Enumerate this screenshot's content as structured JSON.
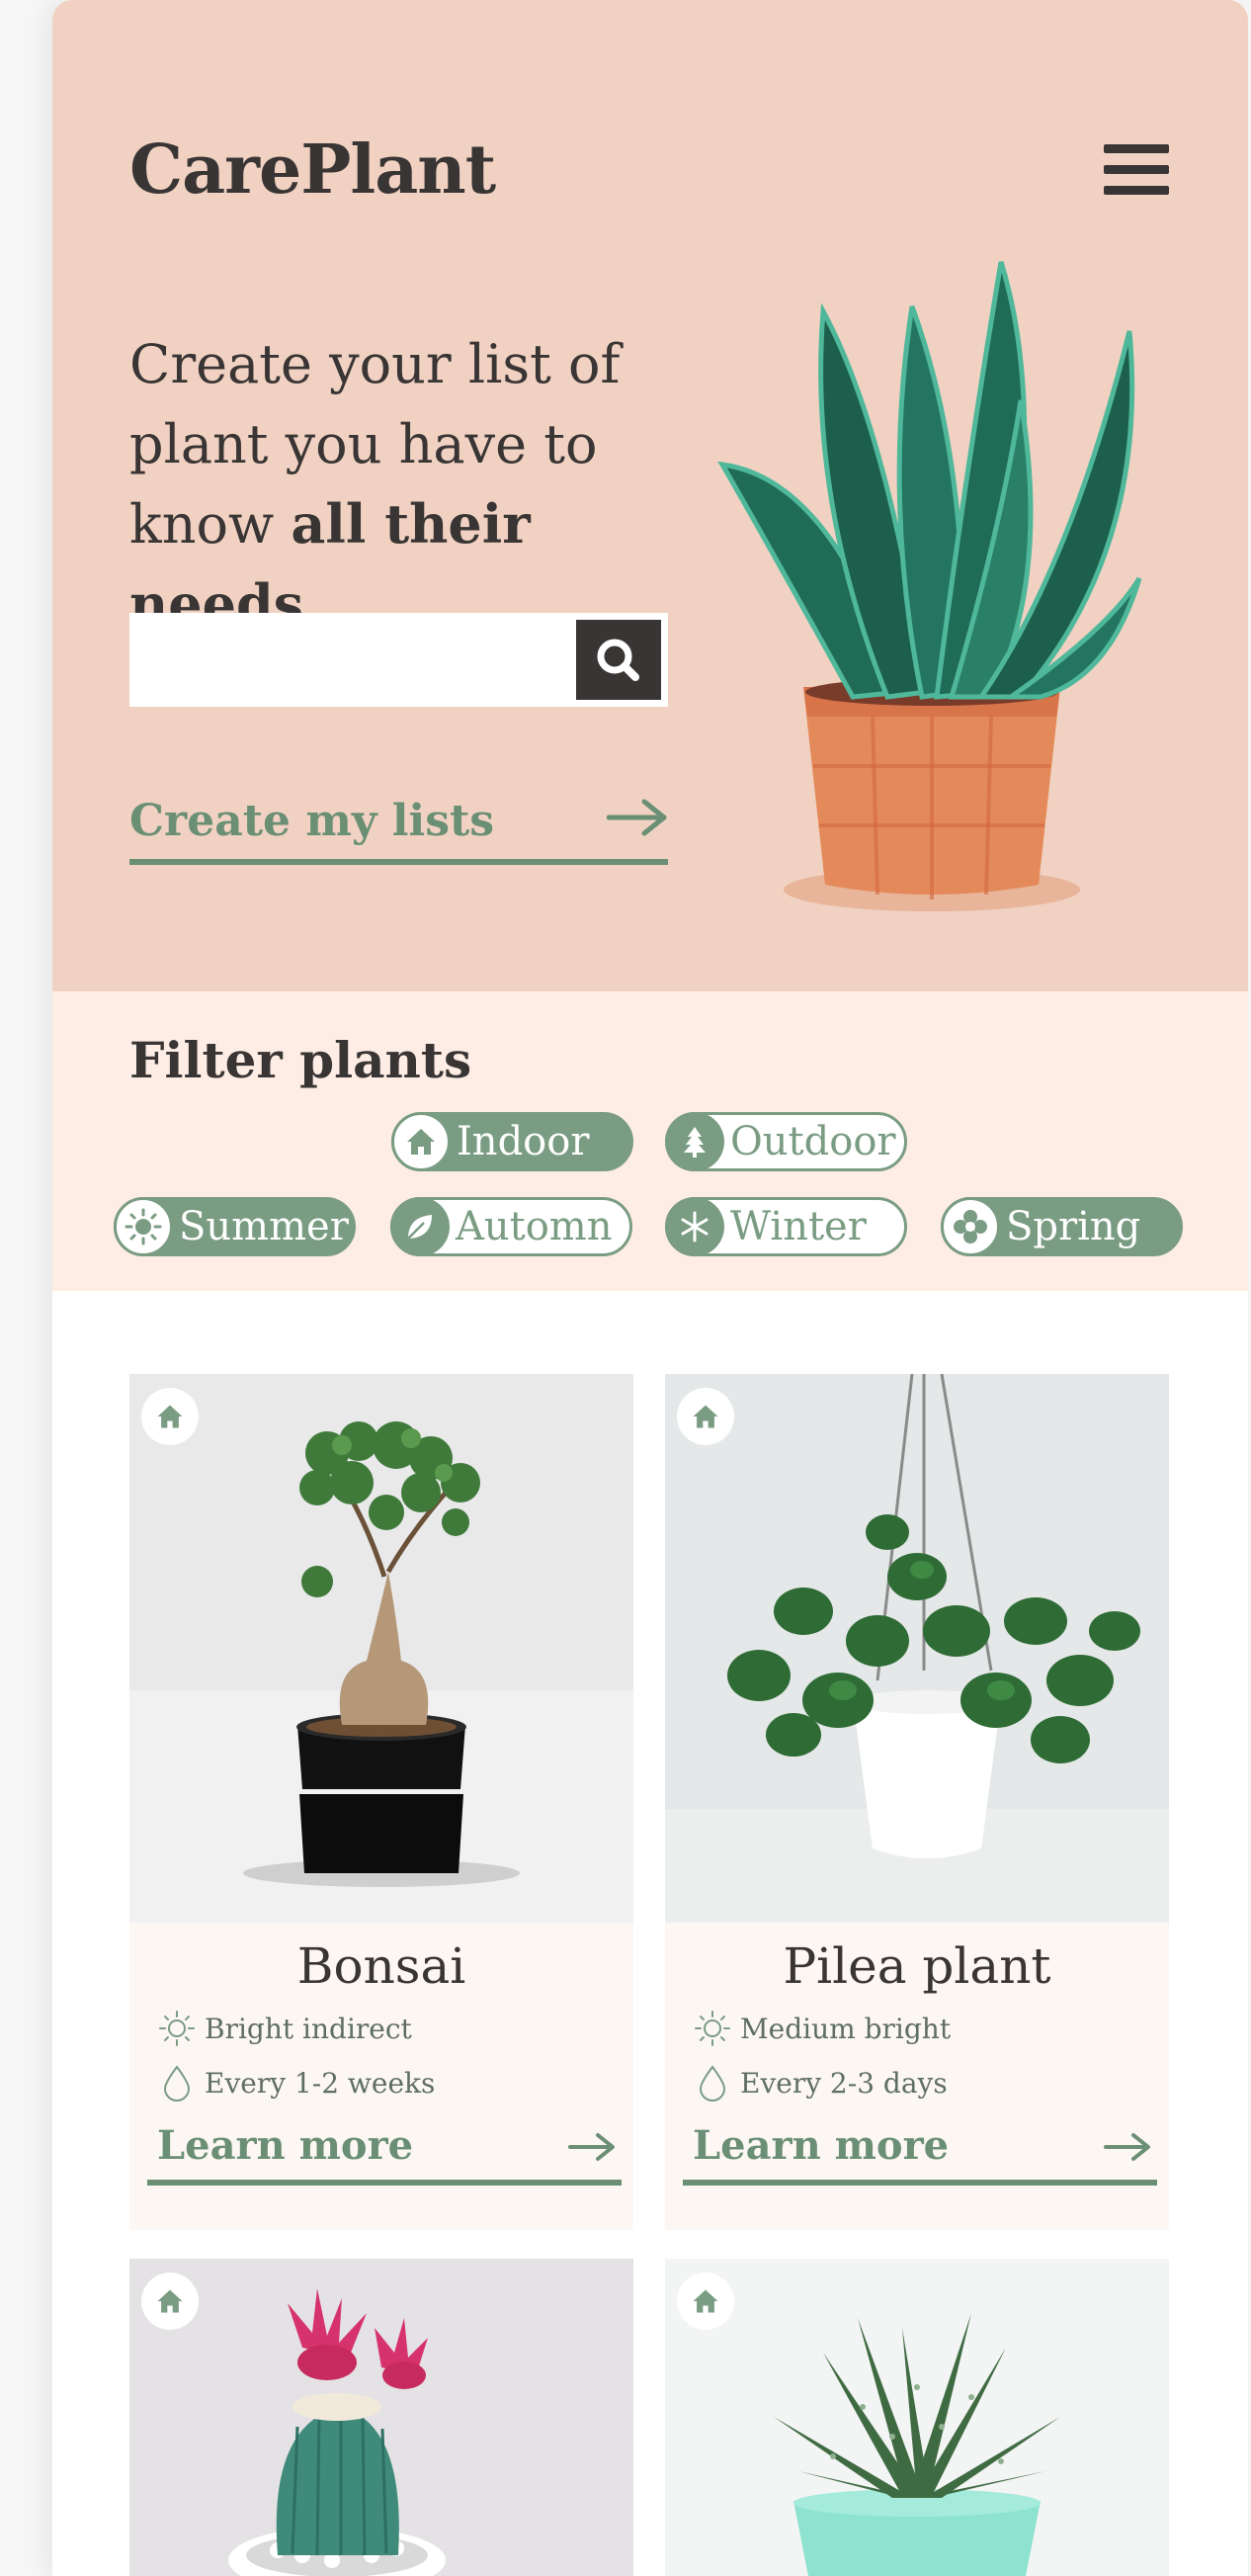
{
  "app": {
    "name": "CarePlant"
  },
  "hero": {
    "tagline_line1": "Create your list of",
    "tagline_line2": "plant you have to",
    "tagline_line3_plain": "know ",
    "tagline_line3_bold": "all their needs",
    "search": {
      "value": "",
      "placeholder": ""
    },
    "cta_label": "Create my lists"
  },
  "filter": {
    "title": "Filter plants",
    "chips": [
      {
        "label": "Indoor",
        "icon": "house-icon",
        "active": true
      },
      {
        "label": "Outdoor",
        "icon": "tree-icon",
        "active": false
      },
      {
        "label": "Summer",
        "icon": "sun-icon",
        "active": true
      },
      {
        "label": "Automn",
        "icon": "leaf-icon",
        "active": false
      },
      {
        "label": "Winter",
        "icon": "snowflake-icon",
        "active": false
      },
      {
        "label": "Spring",
        "icon": "flower-icon",
        "active": true
      }
    ]
  },
  "plants": [
    {
      "name": "Bonsai",
      "light": "Bright indirect",
      "water": "Every 1-2 weeks",
      "link": "Learn more"
    },
    {
      "name": "Pilea plant",
      "light": "Medium bright",
      "water": "Every 2-3 days",
      "link": "Learn more"
    },
    {
      "name": "",
      "light": "",
      "water": "",
      "link": ""
    },
    {
      "name": "",
      "light": "",
      "water": "",
      "link": ""
    }
  ],
  "colors": {
    "hero_bg": "#f1d2c2",
    "filter_bg": "#feede4",
    "accent_green": "#7a9c82",
    "link_green": "#6b8f74",
    "text_dark": "#3a3535",
    "card_bg": "#fdf7f3"
  }
}
